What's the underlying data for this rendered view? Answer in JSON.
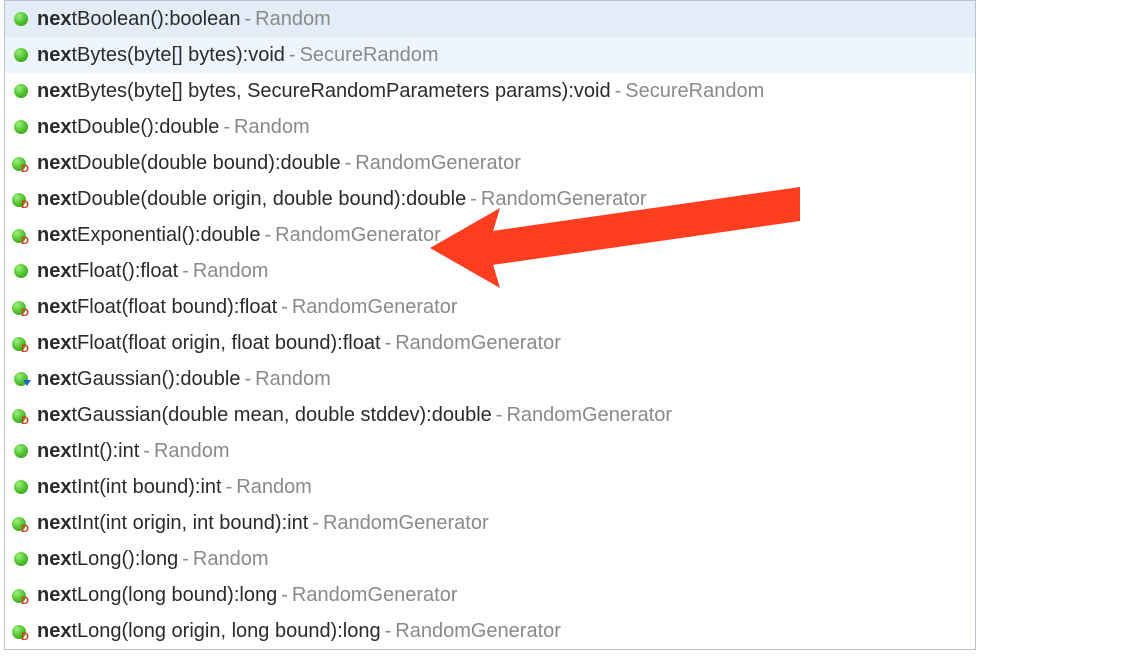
{
  "items": [
    {
      "icon": "method-public",
      "prefix": "nex",
      "name": "tBoolean()",
      "ret": "boolean",
      "source": "Random",
      "selected": true
    },
    {
      "icon": "method-public",
      "prefix": "nex",
      "name": "tBytes(byte[] bytes)",
      "ret": "void",
      "source": "SecureRandom",
      "hover": true
    },
    {
      "icon": "method-public",
      "prefix": "nex",
      "name": "tBytes(byte[] bytes, SecureRandomParameters params)",
      "ret": "void",
      "source": "SecureRandom"
    },
    {
      "icon": "method-public",
      "prefix": "nex",
      "name": "tDouble()",
      "ret": "double",
      "source": "Random"
    },
    {
      "icon": "method-default",
      "prefix": "nex",
      "name": "tDouble(double bound)",
      "ret": "double",
      "source": "RandomGenerator"
    },
    {
      "icon": "method-default",
      "prefix": "nex",
      "name": "tDouble(double origin, double bound)",
      "ret": "double",
      "source": "RandomGenerator"
    },
    {
      "icon": "method-default",
      "prefix": "nex",
      "name": "tExponential()",
      "ret": "double",
      "source": "RandomGenerator"
    },
    {
      "icon": "method-public",
      "prefix": "nex",
      "name": "tFloat()",
      "ret": "float",
      "source": "Random"
    },
    {
      "icon": "method-default",
      "prefix": "nex",
      "name": "tFloat(float bound)",
      "ret": "float",
      "source": "RandomGenerator"
    },
    {
      "icon": "method-default",
      "prefix": "nex",
      "name": "tFloat(float origin, float bound)",
      "ret": "float",
      "source": "RandomGenerator"
    },
    {
      "icon": "method-override",
      "prefix": "nex",
      "name": "tGaussian()",
      "ret": "double",
      "source": "Random"
    },
    {
      "icon": "method-default",
      "prefix": "nex",
      "name": "tGaussian(double mean, double stddev)",
      "ret": "double",
      "source": "RandomGenerator"
    },
    {
      "icon": "method-public",
      "prefix": "nex",
      "name": "tInt()",
      "ret": "int",
      "source": "Random"
    },
    {
      "icon": "method-public",
      "prefix": "nex",
      "name": "tInt(int bound)",
      "ret": "int",
      "source": "Random"
    },
    {
      "icon": "method-default",
      "prefix": "nex",
      "name": "tInt(int origin, int bound)",
      "ret": "int",
      "source": "RandomGenerator"
    },
    {
      "icon": "method-public",
      "prefix": "nex",
      "name": "tLong()",
      "ret": "long",
      "source": "Random"
    },
    {
      "icon": "method-default",
      "prefix": "nex",
      "name": "tLong(long bound)",
      "ret": "long",
      "source": "RandomGenerator"
    },
    {
      "icon": "method-default",
      "prefix": "nex",
      "name": "tLong(long origin, long bound)",
      "ret": "long",
      "source": "RandomGenerator"
    }
  ],
  "arrow_color": "#ff3d1f"
}
